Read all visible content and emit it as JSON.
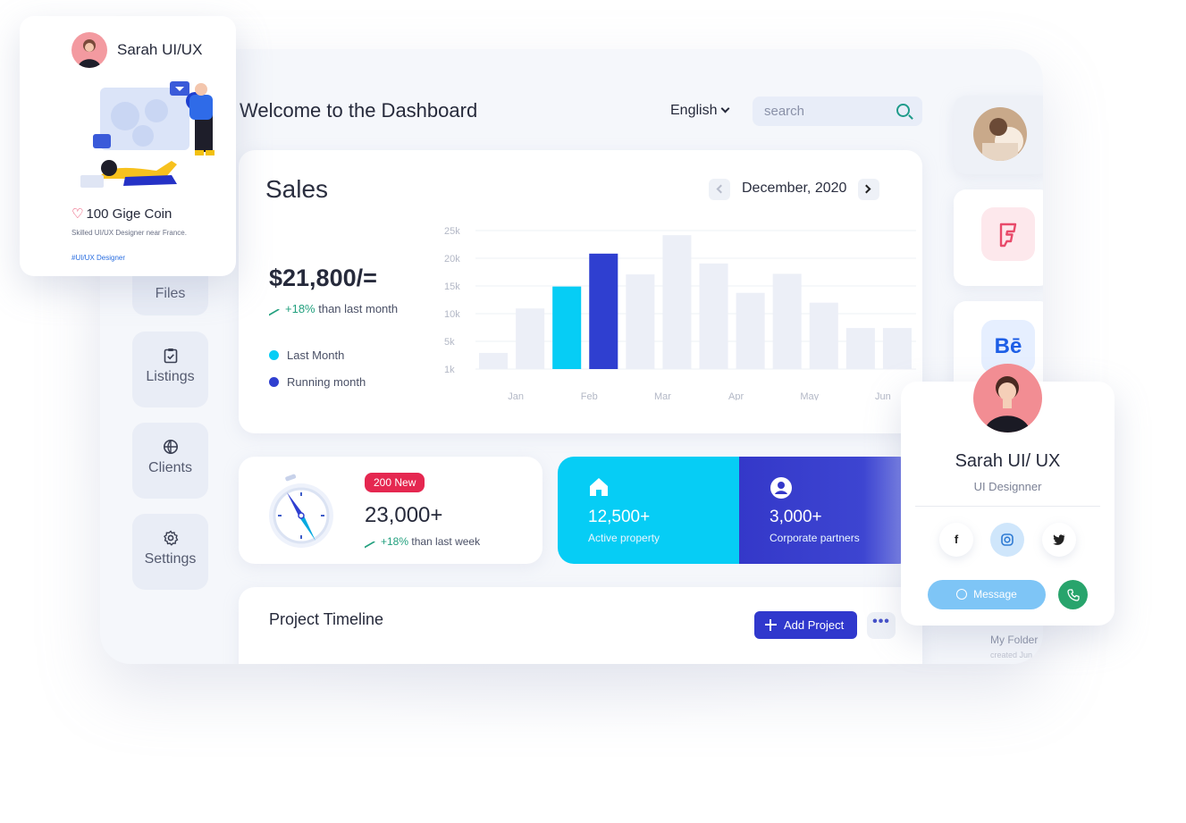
{
  "header": {
    "welcome": "Welcome to the Dashboard",
    "language": "English",
    "search_placeholder": "search"
  },
  "sidebar": {
    "items": [
      {
        "label": "Files",
        "icon": "folder-icon"
      },
      {
        "label": "Listings",
        "icon": "clipboard-check-icon"
      },
      {
        "label": "Clients",
        "icon": "globe-icon"
      },
      {
        "label": "Settings",
        "icon": "gear-icon"
      }
    ]
  },
  "sales": {
    "title": "Sales",
    "month": "December, 2020",
    "amount": "$21,800/=",
    "trend_value": "+18%",
    "trend_text": " than last month",
    "legend": [
      {
        "label": "Last Month",
        "color": "#06cdf5"
      },
      {
        "label": "Running month",
        "color": "#2f3fd0"
      }
    ]
  },
  "chart_data": {
    "type": "bar",
    "ytick_labels": [
      "25k",
      "20k",
      "15k",
      "10k",
      "5k",
      "1k"
    ],
    "xtick_labels": [
      "Jan",
      "Feb",
      "Mar",
      "Apr",
      "May",
      "Jun"
    ],
    "values": [
      3800,
      11500,
      15300,
      21000,
      17400,
      24200,
      19300,
      14200,
      17500,
      12500,
      8100,
      8100
    ],
    "highlight": {
      "2": "#06cdf5",
      "3": "#2f3fd0"
    },
    "base_color": "#eceff7",
    "ylim": [
      1000,
      25000
    ]
  },
  "stats": {
    "badge": "200 New",
    "value": "23,000+",
    "trend_value": "+18%",
    "trend_text": " than last week"
  },
  "banner": {
    "left": {
      "value": "12,500+",
      "label": "Active property"
    },
    "right": {
      "value": "3,000+",
      "label": "Corporate partners"
    }
  },
  "timeline": {
    "title": "Project Timeline",
    "add_label": "Add Project",
    "more_label": "•••"
  },
  "right_column": {
    "folder_label": "My Folder",
    "folder_sub": "created Jun"
  },
  "float_card": {
    "name": "Sarah UI/UX",
    "coin": "100 Gige Coin",
    "desc": "Skilled UI/UX Designer near France.",
    "tag": "#UI/UX Designer"
  },
  "profile_card": {
    "name": "Sarah UI/ UX",
    "role": "UI Designner",
    "socials": [
      "f",
      "ig",
      "tw"
    ],
    "message": "Message"
  }
}
